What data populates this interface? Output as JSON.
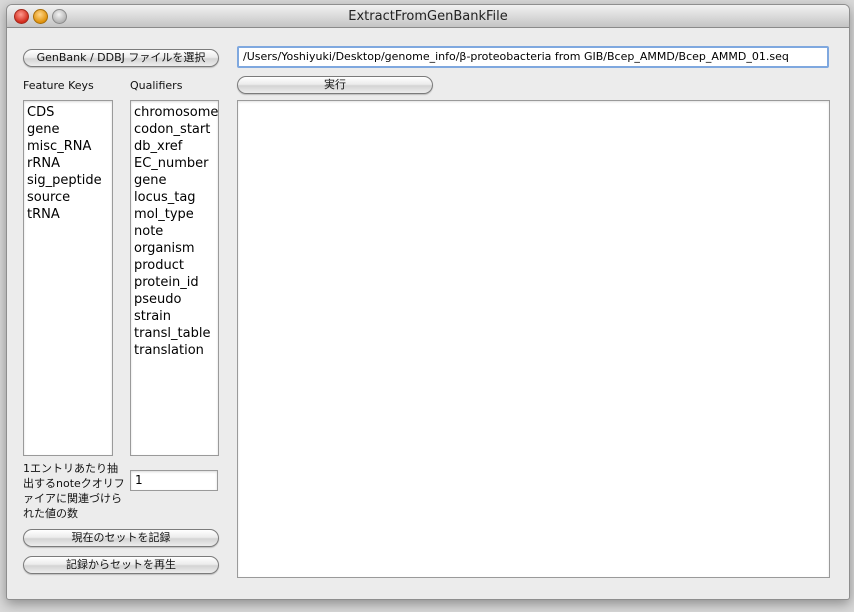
{
  "window": {
    "title": "ExtractFromGenBankFile"
  },
  "toolbar": {
    "select_file_label": "GenBank / DDBJ ファイルを選択",
    "file_path": "/Users/Yoshiyuki/Desktop/genome_info/β-proteobacteria from GIB/Bcep_AMMD/Bcep_AMMD_01.seq",
    "run_label": "実行"
  },
  "feature_keys": {
    "header": "Feature Keys",
    "items": [
      "CDS",
      "gene",
      "misc_RNA",
      "rRNA",
      "sig_peptide",
      "source",
      "tRNA"
    ]
  },
  "qualifiers": {
    "header": "Qualifiers",
    "items": [
      "chromosome",
      "codon_start",
      "db_xref",
      "EC_number",
      "gene",
      "locus_tag",
      "mol_type",
      "note",
      "organism",
      "product",
      "protein_id",
      "pseudo",
      "strain",
      "transl_table",
      "translation"
    ]
  },
  "note_count": {
    "label": "1エントリあたり抽出するnoteクオリファイアに関連づけられた値の数",
    "value": "1"
  },
  "actions": {
    "record_label": "現在のセットを記録",
    "replay_label": "記録からセットを再生"
  },
  "output": {
    "text": ""
  }
}
